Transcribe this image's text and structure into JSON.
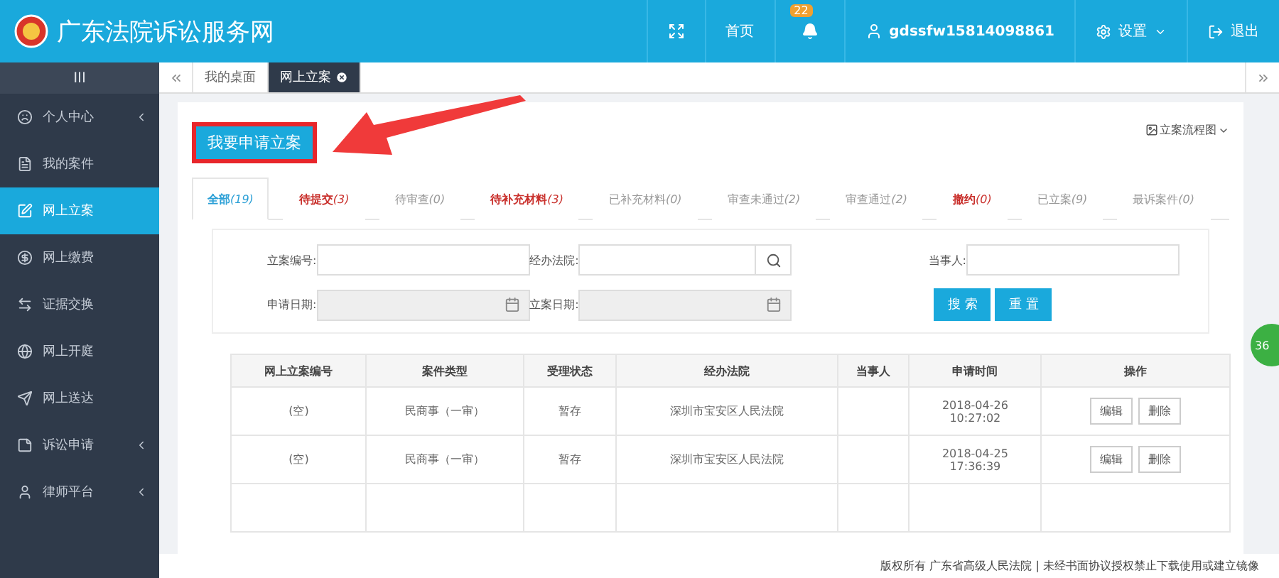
{
  "header": {
    "title": "广东法院诉讼服务网",
    "nav": [
      {
        "kind": "fullscreen"
      },
      {
        "kind": "text",
        "label": "首页"
      },
      {
        "kind": "bell",
        "badge": "22"
      },
      {
        "kind": "user",
        "label": "gdssfw15814098861"
      },
      {
        "kind": "settings",
        "label": "设置"
      },
      {
        "kind": "logout",
        "label": "退出"
      }
    ]
  },
  "sidebar": {
    "toggle": "III",
    "items": [
      {
        "label": "个人中心",
        "expandable": true,
        "selected": false
      },
      {
        "label": "我的案件",
        "expandable": false,
        "selected": false
      },
      {
        "label": "网上立案",
        "expandable": false,
        "selected": true
      },
      {
        "label": "网上缴费",
        "expandable": false,
        "selected": false
      },
      {
        "label": "证据交换",
        "expandable": false,
        "selected": false
      },
      {
        "label": "网上开庭",
        "expandable": false,
        "selected": false
      },
      {
        "label": "网上送达",
        "expandable": false,
        "selected": false
      },
      {
        "label": "诉讼申请",
        "expandable": true,
        "selected": false
      },
      {
        "label": "律师平台",
        "expandable": true,
        "selected": false
      }
    ]
  },
  "page_tabs": [
    {
      "label": "我的桌面",
      "selected": false,
      "closable": false
    },
    {
      "label": "网上立案",
      "selected": true,
      "closable": true
    }
  ],
  "apply_button": "我要申请立案",
  "flow_link": "立案流程图",
  "status_tabs": [
    {
      "label": "全部",
      "count": "(19)",
      "selected": true,
      "color": "#2a9fd6"
    },
    {
      "label": "待提交",
      "count": "(3)",
      "selected": false,
      "color": "#c9302c"
    },
    {
      "label": "待审查",
      "count": "(0)",
      "selected": false,
      "color": "#999999"
    },
    {
      "label": "待补充材料",
      "count": "(3)",
      "selected": false,
      "color": "#c9302c"
    },
    {
      "label": "已补充材料",
      "count": "(0)",
      "selected": false,
      "color": "#999999"
    },
    {
      "label": "审查未通过",
      "count": "(2)",
      "selected": false,
      "color": "#999999"
    },
    {
      "label": "审查通过",
      "count": "(2)",
      "selected": false,
      "color": "#999999"
    },
    {
      "label": "撤约",
      "count": "(0)",
      "selected": false,
      "color": "#c9302c"
    },
    {
      "label": "已立案",
      "count": "(9)",
      "selected": false,
      "color": "#999999"
    },
    {
      "label": "最诉案件",
      "count": "(0)",
      "selected": false,
      "color": "#999999"
    }
  ],
  "filters": [
    {
      "label": "立案编号:",
      "kind": "text"
    },
    {
      "label": "经办法院:",
      "kind": "search"
    },
    {
      "label": "当事人:",
      "kind": "text"
    },
    {
      "label": "申请日期:",
      "kind": "date"
    },
    {
      "label": "立案日期:",
      "kind": "date"
    }
  ],
  "filter_buttons": [
    "搜 索",
    "重 置"
  ],
  "table": {
    "columns": [
      "网上立案编号",
      "案件类型",
      "受理状态",
      "经办法院",
      "当事人",
      "申请时间",
      "操作"
    ],
    "rows": [
      {
        "cells": [
          "(空)",
          "民商事（一审）",
          "暂存",
          "深圳市宝安区人民法院",
          "",
          "2018-04-26\n10:27:02"
        ],
        "actions": [
          "编辑",
          "删除"
        ]
      },
      {
        "cells": [
          "(空)",
          "民商事（一审）",
          "暂存",
          "深圳市宝安区人民法院",
          "",
          "2018-04-25\n17:36:39"
        ],
        "actions": [
          "编辑",
          "删除"
        ]
      }
    ]
  },
  "footer": "版权所有 广东省高级人民法院 | 未经书面协议授权禁止下载使用或建立镜像",
  "float_badge": "36"
}
